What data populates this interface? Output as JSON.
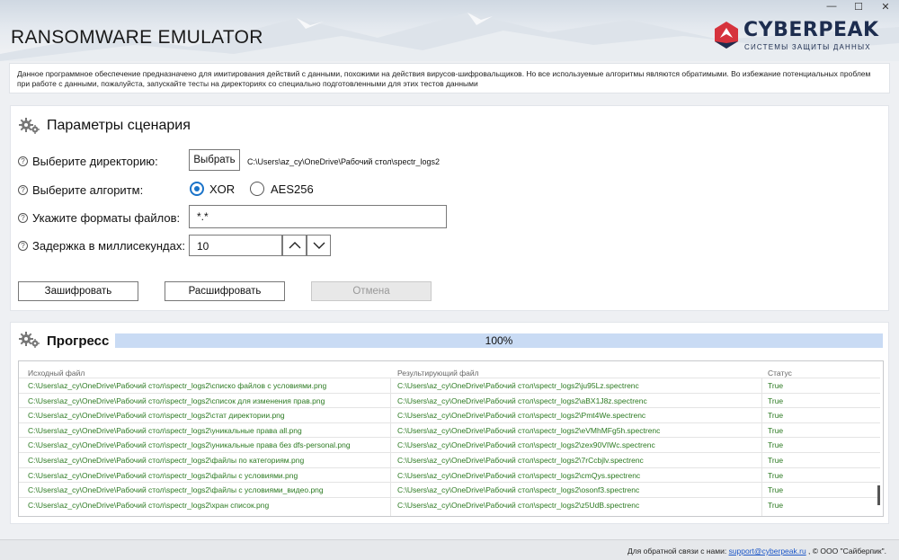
{
  "window": {
    "title": "RANSOMWARE EMULATOR",
    "controls": [
      "—",
      "☐",
      "✕"
    ]
  },
  "logo": {
    "name": "CYBERPEAK",
    "tagline": "СИСТЕМЫ ЗАЩИТЫ ДАННЫХ",
    "colors": {
      "brand": "#1d2d4f",
      "accent": "#d6333d"
    }
  },
  "notice": {
    "text": "Данное программное обеспечение предназначено для имитирования действий с данными, похожими на действия вирусов-шифровальщиков. Но все используемые алгоритмы являются обратимыми. Во избежание потенциальных проблем при работе с данными, пожалуйста, запускайте тесты на директориях со специально подготовленными для этих тестов данными"
  },
  "params": {
    "title": "Параметры сценария",
    "directory": {
      "label": "Выберите директорию:",
      "button": "Выбрать",
      "path": "C:\\Users\\az_cy\\OneDrive\\Рабочий стол\\spectr_logs2"
    },
    "algorithm": {
      "label": "Выберите алгоритм:",
      "options": [
        {
          "label": "XOR",
          "selected": true
        },
        {
          "label": "AES256",
          "selected": false
        }
      ]
    },
    "formats": {
      "label": "Укажите форматы файлов:",
      "value": "*.*"
    },
    "delay": {
      "label": "Задержка в миллисекундах:",
      "value": "10"
    },
    "actions": {
      "encrypt": "Зашифровать",
      "decrypt": "Расшифровать",
      "cancel": "Отмена"
    },
    "help_glyph": "?"
  },
  "progress": {
    "title": "Прогресс",
    "percent_text": "100%",
    "fraction": 1.0,
    "bar_color": "#cfdff5",
    "table": {
      "columns": [
        "Исходный файл",
        "Результирующий файл",
        "Статус"
      ],
      "rows": [
        [
          "C:\\Users\\az_cy\\OneDrive\\Рабочий стол\\spectr_logs2\\списко файлов с условиями.png",
          "C:\\Users\\az_cy\\OneDrive\\Рабочий стол\\spectr_logs2\\ju95Lz.spectrenc",
          "True"
        ],
        [
          "C:\\Users\\az_cy\\OneDrive\\Рабочий стол\\spectr_logs2\\список для изменения прав.png",
          "C:\\Users\\az_cy\\OneDrive\\Рабочий стол\\spectr_logs2\\aBX1J8z.spectrenc",
          "True"
        ],
        [
          "C:\\Users\\az_cy\\OneDrive\\Рабочий стол\\spectr_logs2\\стат директории.png",
          "C:\\Users\\az_cy\\OneDrive\\Рабочий стол\\spectr_logs2\\Pmt4We.spectrenc",
          "True"
        ],
        [
          "C:\\Users\\az_cy\\OneDrive\\Рабочий стол\\spectr_logs2\\уникальные права all.png",
          "C:\\Users\\az_cy\\OneDrive\\Рабочий стол\\spectr_logs2\\eVMhMFg5h.spectrenc",
          "True"
        ],
        [
          "C:\\Users\\az_cy\\OneDrive\\Рабочий стол\\spectr_logs2\\уникальные права без dfs-personal.png",
          "C:\\Users\\az_cy\\OneDrive\\Рабочий стол\\spectr_logs2\\zex90VIWc.spectrenc",
          "True"
        ],
        [
          "C:\\Users\\az_cy\\OneDrive\\Рабочий стол\\spectr_logs2\\файлы по категориям.png",
          "C:\\Users\\az_cy\\OneDrive\\Рабочий стол\\spectr_logs2\\7rCcbjlv.spectrenc",
          "True"
        ],
        [
          "C:\\Users\\az_cy\\OneDrive\\Рабочий стол\\spectr_logs2\\файлы с условиями.png",
          "C:\\Users\\az_cy\\OneDrive\\Рабочий стол\\spectr_logs2\\cmQys.spectrenc",
          "True"
        ],
        [
          "C:\\Users\\az_cy\\OneDrive\\Рабочий стол\\spectr_logs2\\файлы с условиями_видео.png",
          "C:\\Users\\az_cy\\OneDrive\\Рабочий стол\\spectr_logs2\\osonf3.spectrenc",
          "True"
        ],
        [
          "C:\\Users\\az_cy\\OneDrive\\Рабочий стол\\spectr_logs2\\хран список.png",
          "C:\\Users\\az_cy\\OneDrive\\Рабочий стол\\spectr_logs2\\z5UdB.spectrenc",
          "True"
        ]
      ]
    }
  },
  "footer": {
    "prefix": "Для обратной связи с нами: ",
    "email": "support@cyberpeak.ru",
    "suffix": " , © ООО \"Сайберпик\"."
  }
}
